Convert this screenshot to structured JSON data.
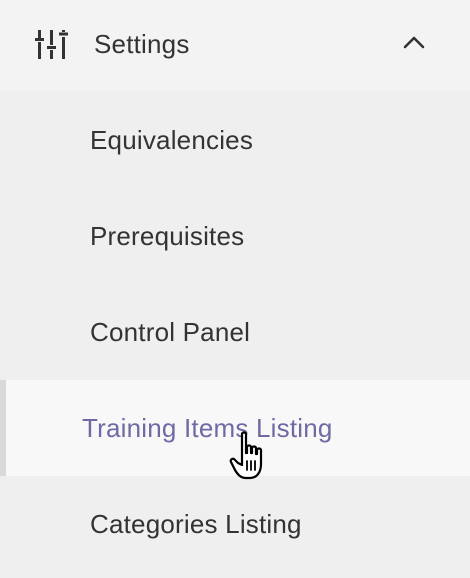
{
  "settings": {
    "title": "Settings",
    "icon": "sliders-icon",
    "expanded": true
  },
  "items": [
    {
      "label": "Equivalencies",
      "active": false
    },
    {
      "label": "Prerequisites",
      "active": false
    },
    {
      "label": "Control Panel",
      "active": false
    },
    {
      "label": "Training Items Listing",
      "active": true
    },
    {
      "label": "Categories Listing",
      "active": false
    }
  ],
  "colors": {
    "active_text": "#6f6aa3",
    "text": "#333333",
    "background": "#efefef",
    "active_background": "#f8f8f8"
  }
}
